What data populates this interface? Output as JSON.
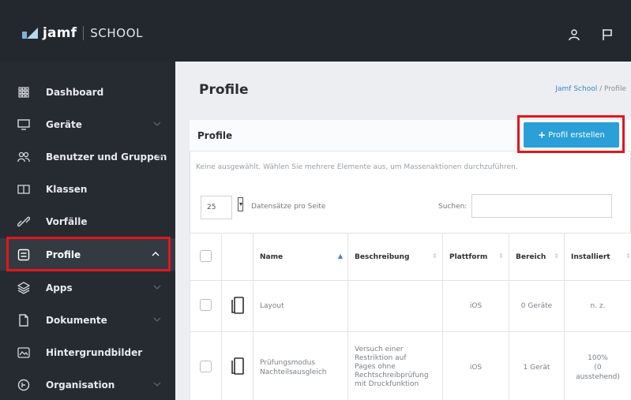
{
  "app": {
    "brand_name": "jamf",
    "brand_product": "SCHOOL"
  },
  "topbar": {
    "icons": [
      "user-icon",
      "flag-icon"
    ]
  },
  "sidebar": {
    "items": [
      {
        "label": "Dashboard",
        "icon": "grid-icon",
        "has_chevron": false
      },
      {
        "label": "Geräte",
        "icon": "monitor-icon",
        "has_chevron": true
      },
      {
        "label": "Benutzer und Gruppen",
        "icon": "users-icon",
        "has_chevron": true
      },
      {
        "label": "Klassen",
        "icon": "book-icon",
        "has_chevron": false
      },
      {
        "label": "Vorfälle",
        "icon": "link-icon",
        "has_chevron": false
      },
      {
        "label": "Profile",
        "icon": "profile-icon",
        "has_chevron": true,
        "active": true
      },
      {
        "label": "Apps",
        "icon": "apps-icon",
        "has_chevron": true
      },
      {
        "label": "Dokumente",
        "icon": "document-icon",
        "has_chevron": true
      },
      {
        "label": "Hintergrundbilder",
        "icon": "image-icon",
        "has_chevron": false
      },
      {
        "label": "Organisation",
        "icon": "organisation-icon",
        "has_chevron": true
      }
    ]
  },
  "page": {
    "title": "Profile",
    "breadcrumb": [
      "Jamf School",
      "Profile"
    ],
    "breadcrumb_sep": "/"
  },
  "card": {
    "title": "Profile",
    "create_button": "Profil erstellen",
    "hint": "Keine ausgewählt. Wählen Sie mehrere Elemente aus, um Massenaktionen durchzuführen.",
    "page_length": "25",
    "page_length_label": "Datensätze pro Seite",
    "search_label": "Suchen:",
    "search_value": ""
  },
  "table": {
    "headers": [
      "Name",
      "Beschreibung",
      "Plattform",
      "Bereich",
      "Installiert"
    ],
    "rows": [
      {
        "name": "Layout",
        "name_lines": [
          "Layout"
        ],
        "description_lines": [],
        "platform": "iOS",
        "scope": "0 Geräte",
        "installed_lines": [
          "n. z."
        ]
      },
      {
        "name": "Prüfungsmodus Nachteilsausgleich",
        "name_lines": [
          "Prüfungsmodus",
          "Nachteilsausgleich"
        ],
        "description_lines": [
          "Versuch einer",
          "Restriktion auf",
          "Pages ohne",
          "Rechtschreibprüfung",
          "mit Druckfunktion"
        ],
        "platform": "iOS",
        "scope": "1 Gerät",
        "installed_lines": [
          "100%",
          "(0",
          "ausstehend)"
        ]
      }
    ]
  },
  "colors": {
    "topbar_bg": "#23282e",
    "sidebar_bg": "#262b31",
    "accent_blue": "#2a9fd8",
    "highlight_red": "#e3161c",
    "link_blue": "#3a86c8"
  }
}
